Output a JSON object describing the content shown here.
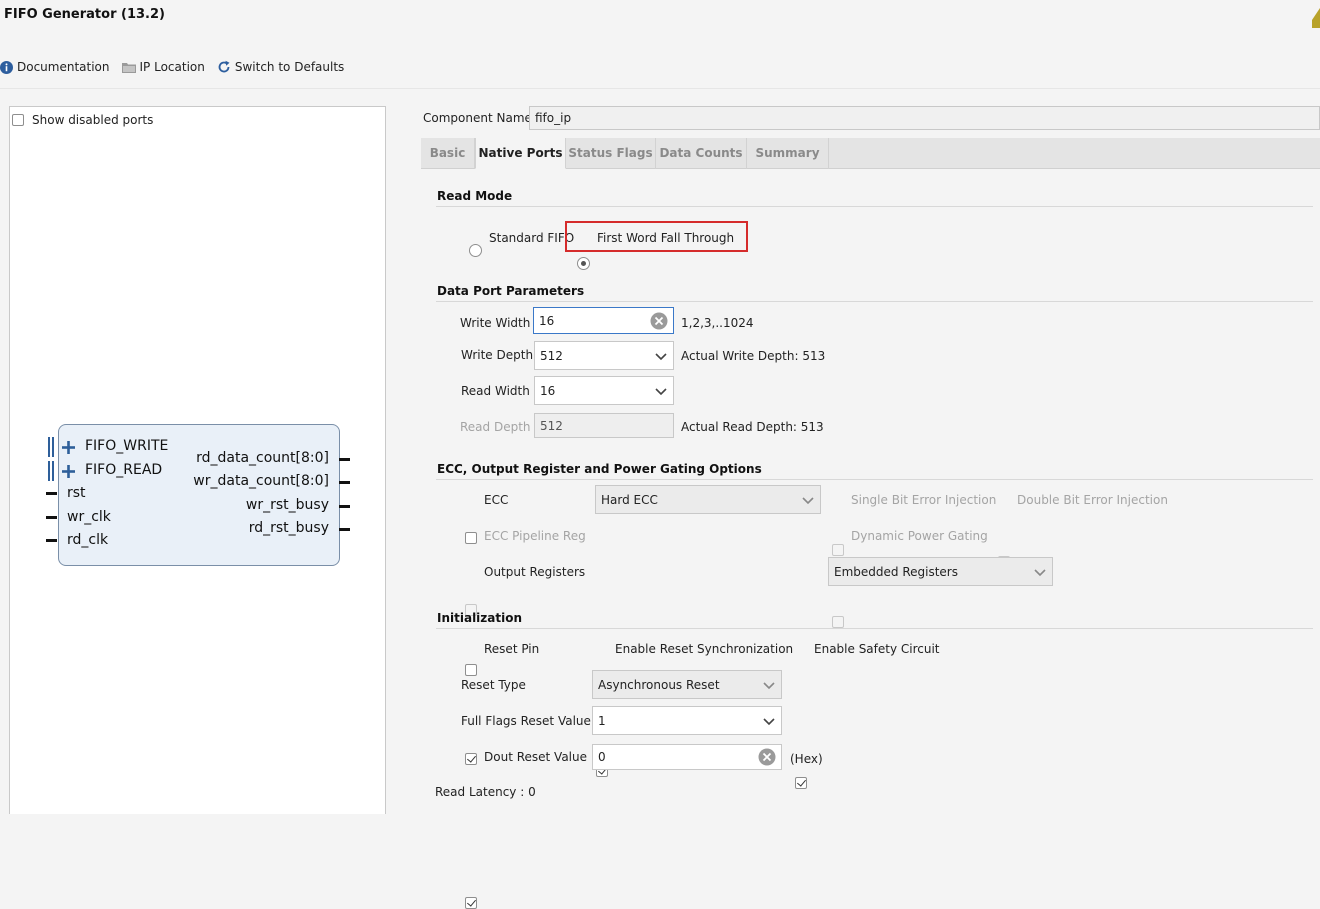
{
  "window": {
    "title": "FIFO Generator (13.2)"
  },
  "toolbar": {
    "documentation": "Documentation",
    "ip_location": "IP Location",
    "switch_defaults": "Switch to Defaults"
  },
  "left_panel": {
    "show_disabled_ports": "Show disabled ports",
    "block": {
      "left_ports": [
        "FIFO_WRITE",
        "FIFO_READ",
        "rst",
        "wr_clk",
        "rd_clk"
      ],
      "right_ports": [
        "rd_data_count[8:0]",
        "wr_data_count[8:0]",
        "wr_rst_busy",
        "rd_rst_busy"
      ]
    }
  },
  "component": {
    "label": "Component Name",
    "value": "fifo_ip"
  },
  "tabs": [
    "Basic",
    "Native Ports",
    "Status Flags",
    "Data Counts",
    "Summary"
  ],
  "read_mode": {
    "title": "Read Mode",
    "standard": "Standard FIFO",
    "fwft": "First Word Fall Through"
  },
  "data_port": {
    "title": "Data Port Parameters",
    "write_width_label": "Write Width",
    "write_width_value": "16",
    "write_width_hint": "1,2,3,..1024",
    "write_depth_label": "Write Depth",
    "write_depth_value": "512",
    "write_depth_hint": "Actual Write Depth: 513",
    "read_width_label": "Read Width",
    "read_width_value": "16",
    "read_depth_label": "Read Depth",
    "read_depth_value": "512",
    "read_depth_hint": "Actual Read Depth: 513"
  },
  "ecc": {
    "title": "ECC, Output Register and Power Gating Options",
    "ecc_label": "ECC",
    "ecc_type": "Hard ECC",
    "single_bit": "Single Bit Error Injection",
    "double_bit": "Double Bit Error Injection",
    "pipeline_reg": "ECC Pipeline Reg",
    "dynamic_power": "Dynamic Power Gating",
    "output_registers": "Output Registers",
    "output_reg_type": "Embedded Registers"
  },
  "init": {
    "title": "Initialization",
    "reset_pin": "Reset Pin",
    "enable_reset_sync": "Enable Reset Synchronization",
    "enable_safety": "Enable Safety Circuit",
    "reset_type_label": "Reset Type",
    "reset_type_value": "Asynchronous Reset",
    "full_flags_label": "Full Flags Reset Value",
    "full_flags_value": "1",
    "dout_reset_label": "Dout Reset Value",
    "dout_reset_value": "0",
    "hex": "(Hex)",
    "read_latency": "Read Latency : 0"
  },
  "colors": {
    "highlight": "#d52b2b",
    "focus": "#3a78c8",
    "block_fill": "#e9f0f8"
  }
}
